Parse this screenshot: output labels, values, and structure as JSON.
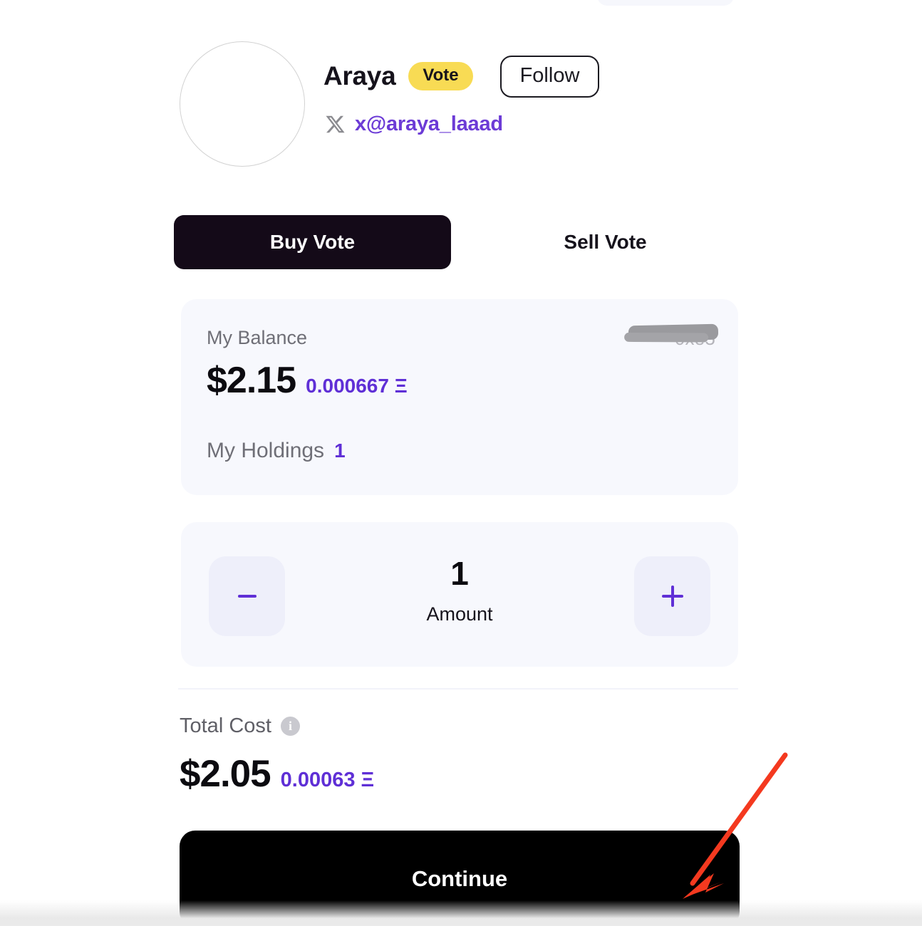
{
  "profile": {
    "avatar_alt": "empty-avatar",
    "display_name": "Araya",
    "badge_label": "Vote",
    "follow_label": "Follow",
    "social_icon": "x-twitter-icon",
    "handle": "x@araya_laaad"
  },
  "tabs": [
    {
      "label": "Buy Vote",
      "active": true
    },
    {
      "label": "Sell Vote",
      "active": false
    }
  ],
  "balance_card": {
    "label": "My Balance",
    "wallet_address": "0xe5",
    "usd_amount": "$2.15",
    "eth_amount": "0.000667 Ξ",
    "holdings_label": "My Holdings",
    "holdings_value": "1"
  },
  "stepper": {
    "decrement_icon": "minus-icon",
    "increment_icon": "plus-icon",
    "value": "1",
    "label": "Amount"
  },
  "total": {
    "label": "Total Cost",
    "info_icon": "info-icon",
    "info_glyph": "i",
    "usd_amount": "$2.05",
    "eth_amount": "0.00063 Ξ"
  },
  "primary_action": {
    "label": "Continue"
  },
  "annotation": {
    "type": "arrow",
    "color": "#f4391f",
    "points_to": "continue-button"
  },
  "colors": {
    "accent_purple": "#5f2fd6",
    "badge_yellow": "#f8db54",
    "tab_active_bg": "#140a18",
    "card_bg": "#f7f8fd",
    "button_black": "#000000",
    "annotation_red": "#f4391f"
  }
}
